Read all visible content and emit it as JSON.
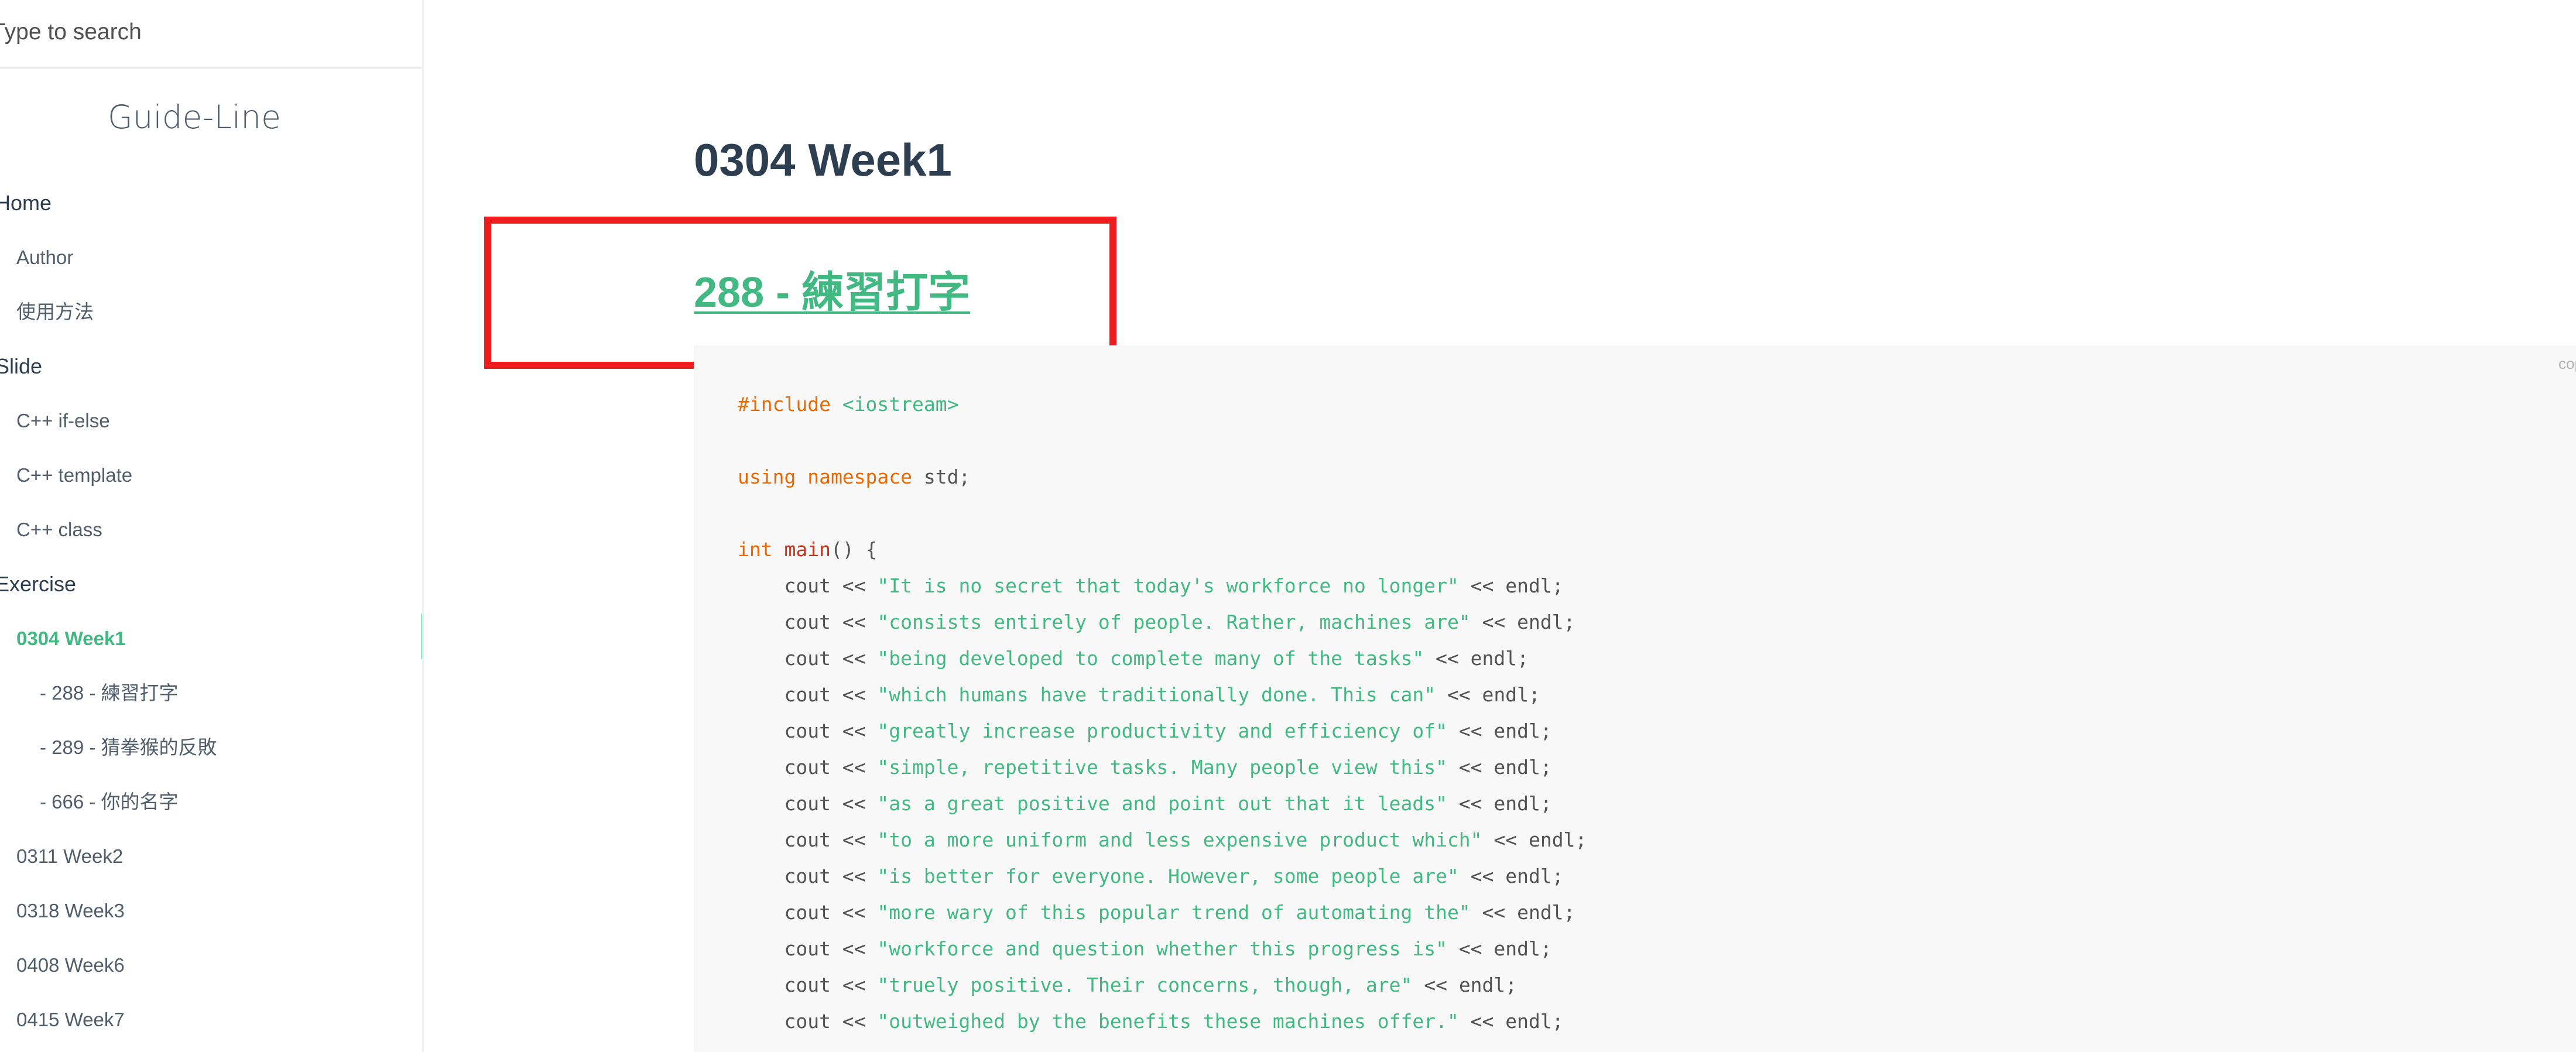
{
  "search": {
    "placeholder": "Type to search"
  },
  "sidebar": {
    "app_name": "Guide-Line",
    "items": [
      {
        "label": "Home",
        "level": "section"
      },
      {
        "label": "Author",
        "level": "sub"
      },
      {
        "label": "使用方法",
        "level": "sub"
      },
      {
        "label": "Slide",
        "level": "section"
      },
      {
        "label": "C++ if-else",
        "level": "sub"
      },
      {
        "label": "C++ template",
        "level": "sub"
      },
      {
        "label": "C++ class",
        "level": "sub"
      },
      {
        "label": "Exercise",
        "level": "section"
      },
      {
        "label": "0304 Week1",
        "level": "sub",
        "active": true
      },
      {
        "label": "- 288 - 練習打字",
        "level": "subsub"
      },
      {
        "label": "- 289 - 猜拳猴的反敗",
        "level": "subsub"
      },
      {
        "label": "- 666 - 你的名字",
        "level": "subsub"
      },
      {
        "label": "0311 Week2",
        "level": "sub"
      },
      {
        "label": "0318 Week3",
        "level": "sub"
      },
      {
        "label": "0408 Week6",
        "level": "sub"
      },
      {
        "label": "0415 Week7",
        "level": "sub"
      }
    ]
  },
  "main": {
    "page_title": "0304 Week1",
    "problem_link": "288 - 練習打字",
    "copy_label": "copy",
    "code_lines": [
      [
        {
          "t": "#include ",
          "c": "kw"
        },
        {
          "t": "<iostream>",
          "c": "str"
        }
      ],
      [],
      [
        {
          "t": "using namespace",
          "c": "kw"
        },
        {
          "t": " std;",
          "c": "plain"
        }
      ],
      [],
      [
        {
          "t": "int",
          "c": "kw"
        },
        {
          "t": " ",
          "c": "plain"
        },
        {
          "t": "main",
          "c": "fn"
        },
        {
          "t": "() {",
          "c": "plain"
        }
      ],
      [
        {
          "t": "    cout << ",
          "c": "plain"
        },
        {
          "t": "\"It is no secret that today's workforce no longer\"",
          "c": "str"
        },
        {
          "t": " << endl;",
          "c": "plain"
        }
      ],
      [
        {
          "t": "    cout << ",
          "c": "plain"
        },
        {
          "t": "\"consists entirely of people. Rather, machines are\"",
          "c": "str"
        },
        {
          "t": " << endl;",
          "c": "plain"
        }
      ],
      [
        {
          "t": "    cout << ",
          "c": "plain"
        },
        {
          "t": "\"being developed to complete many of the tasks\"",
          "c": "str"
        },
        {
          "t": " << endl;",
          "c": "plain"
        }
      ],
      [
        {
          "t": "    cout << ",
          "c": "plain"
        },
        {
          "t": "\"which humans have traditionally done. This can\"",
          "c": "str"
        },
        {
          "t": " << endl;",
          "c": "plain"
        }
      ],
      [
        {
          "t": "    cout << ",
          "c": "plain"
        },
        {
          "t": "\"greatly increase productivity and efficiency of\"",
          "c": "str"
        },
        {
          "t": " << endl;",
          "c": "plain"
        }
      ],
      [
        {
          "t": "    cout << ",
          "c": "plain"
        },
        {
          "t": "\"simple, repetitive tasks. Many people view this\"",
          "c": "str"
        },
        {
          "t": " << endl;",
          "c": "plain"
        }
      ],
      [
        {
          "t": "    cout << ",
          "c": "plain"
        },
        {
          "t": "\"as a great positive and point out that it leads\"",
          "c": "str"
        },
        {
          "t": " << endl;",
          "c": "plain"
        }
      ],
      [
        {
          "t": "    cout << ",
          "c": "plain"
        },
        {
          "t": "\"to a more uniform and less expensive product which\"",
          "c": "str"
        },
        {
          "t": " << endl;",
          "c": "plain"
        }
      ],
      [
        {
          "t": "    cout << ",
          "c": "plain"
        },
        {
          "t": "\"is better for everyone. However, some people are\"",
          "c": "str"
        },
        {
          "t": " << endl;",
          "c": "plain"
        }
      ],
      [
        {
          "t": "    cout << ",
          "c": "plain"
        },
        {
          "t": "\"more wary of this popular trend of automating the\"",
          "c": "str"
        },
        {
          "t": " << endl;",
          "c": "plain"
        }
      ],
      [
        {
          "t": "    cout << ",
          "c": "plain"
        },
        {
          "t": "\"workforce and question whether this progress is\"",
          "c": "str"
        },
        {
          "t": " << endl;",
          "c": "plain"
        }
      ],
      [
        {
          "t": "    cout << ",
          "c": "plain"
        },
        {
          "t": "\"truely positive. Their concerns, though, are\"",
          "c": "str"
        },
        {
          "t": " << endl;",
          "c": "plain"
        }
      ],
      [
        {
          "t": "    cout << ",
          "c": "plain"
        },
        {
          "t": "\"outweighed by the benefits these machines offer.\"",
          "c": "str"
        },
        {
          "t": " << endl;",
          "c": "plain"
        }
      ],
      [
        {
          "t": "    ",
          "c": "plain"
        }
      ]
    ]
  },
  "colors": {
    "accent": "#42b983",
    "highlight_border": "#ee1c1c",
    "keyword": "#e96900",
    "code_bg": "#f8f8f8"
  }
}
